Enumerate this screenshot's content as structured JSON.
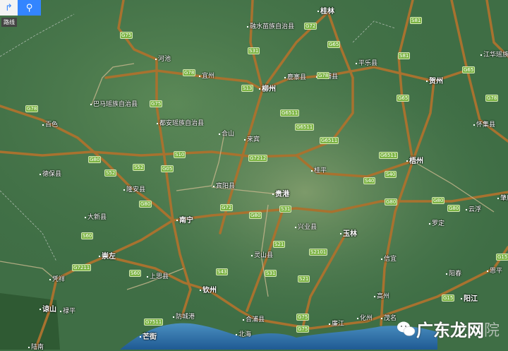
{
  "controls": {
    "route_tooltip": "路线",
    "route_icon": "route-icon",
    "search_icon": "search-icon"
  },
  "cities": [
    "河池",
    "巴马瑶族自治县",
    "融水苗族自治县",
    "桂林",
    "宜州",
    "鹿寨县",
    "柳州",
    "荔浦县",
    "平乐县",
    "贺州",
    "江华瑶族自治",
    "百色",
    "都安瑶族自治县",
    "合山",
    "来宾",
    "桂平",
    "梧州",
    "怀集县",
    "德保县",
    "隆安县",
    "宾阳县",
    "贵港",
    "大新县",
    "南宁",
    "兴业县",
    "玉林",
    "肇庆",
    "云浮",
    "罗定",
    "崇左",
    "上思县",
    "灵山县",
    "钦州",
    "凭祥",
    "谅山",
    "禄平",
    "防城港",
    "合浦县",
    "北海",
    "芒街",
    "陆南",
    "廉江",
    "化州",
    "茂名",
    "信宜",
    "高州",
    "阳春",
    "阳江",
    "恩平"
  ],
  "shields": [
    "G75",
    "G75",
    "G78",
    "S31",
    "G72",
    "G65",
    "G78",
    "G78",
    "S13",
    "G6511",
    "S81",
    "S81",
    "G65",
    "G65",
    "G78",
    "G80",
    "S52",
    "S52",
    "G05",
    "G6511",
    "G6511",
    "G6511",
    "S10",
    "G7212",
    "S40",
    "S40",
    "G80",
    "G72",
    "G80",
    "S31",
    "G80",
    "G80",
    "G80",
    "S60",
    "G7211",
    "S60",
    "S43",
    "S31",
    "S21",
    "S2101",
    "S21",
    "G75",
    "G7511",
    "G15",
    "G15",
    "G75"
  ],
  "watermark": {
    "text": "广东龙网",
    "suffix": "院"
  },
  "colors": {
    "land": "#3f6e45",
    "sea": "#2f6fa8",
    "road": "#a8722f",
    "search": "#3385ff"
  }
}
